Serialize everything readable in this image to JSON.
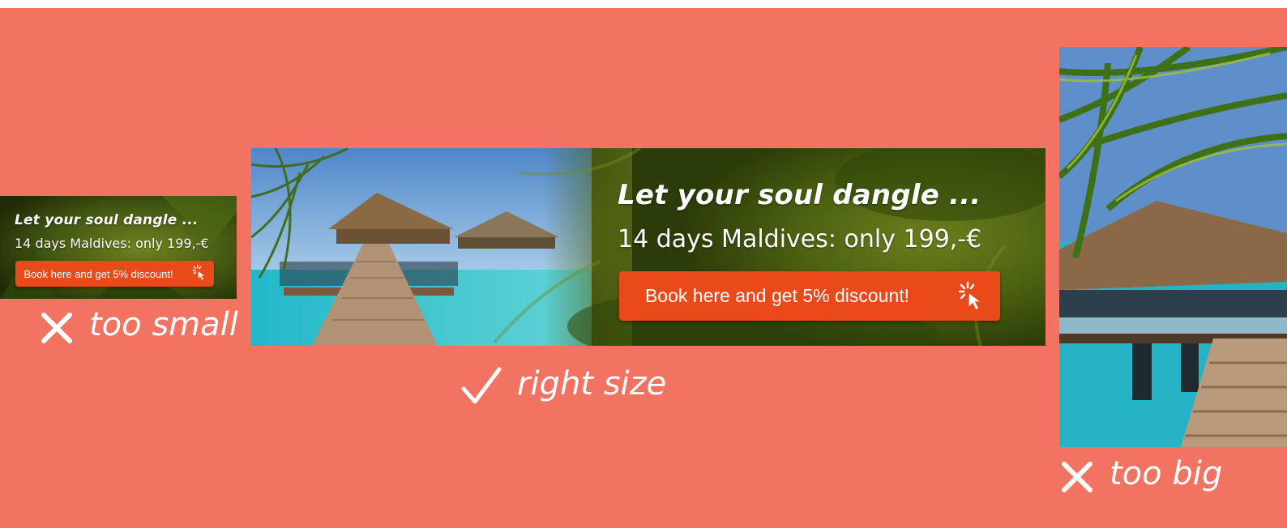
{
  "banners": {
    "small": {
      "headline": "Let your soul dangle ...",
      "subline": "14 days Maldives: only 199,-€",
      "cta_label": "Book here and get 5% discount!"
    },
    "medium": {
      "headline": "Let your soul dangle ...",
      "subline": "14 days Maldives: only 199,-€",
      "cta_label": "Book here and get 5% discount!"
    }
  },
  "captions": {
    "small": {
      "icon": "cross-icon",
      "text": "too small"
    },
    "medium": {
      "icon": "check-icon",
      "text": "right size"
    },
    "big": {
      "icon": "cross-icon",
      "text": "too big"
    }
  },
  "colors": {
    "background": "#f27361",
    "cta": "#ea4a1a",
    "text": "#ffffff"
  }
}
